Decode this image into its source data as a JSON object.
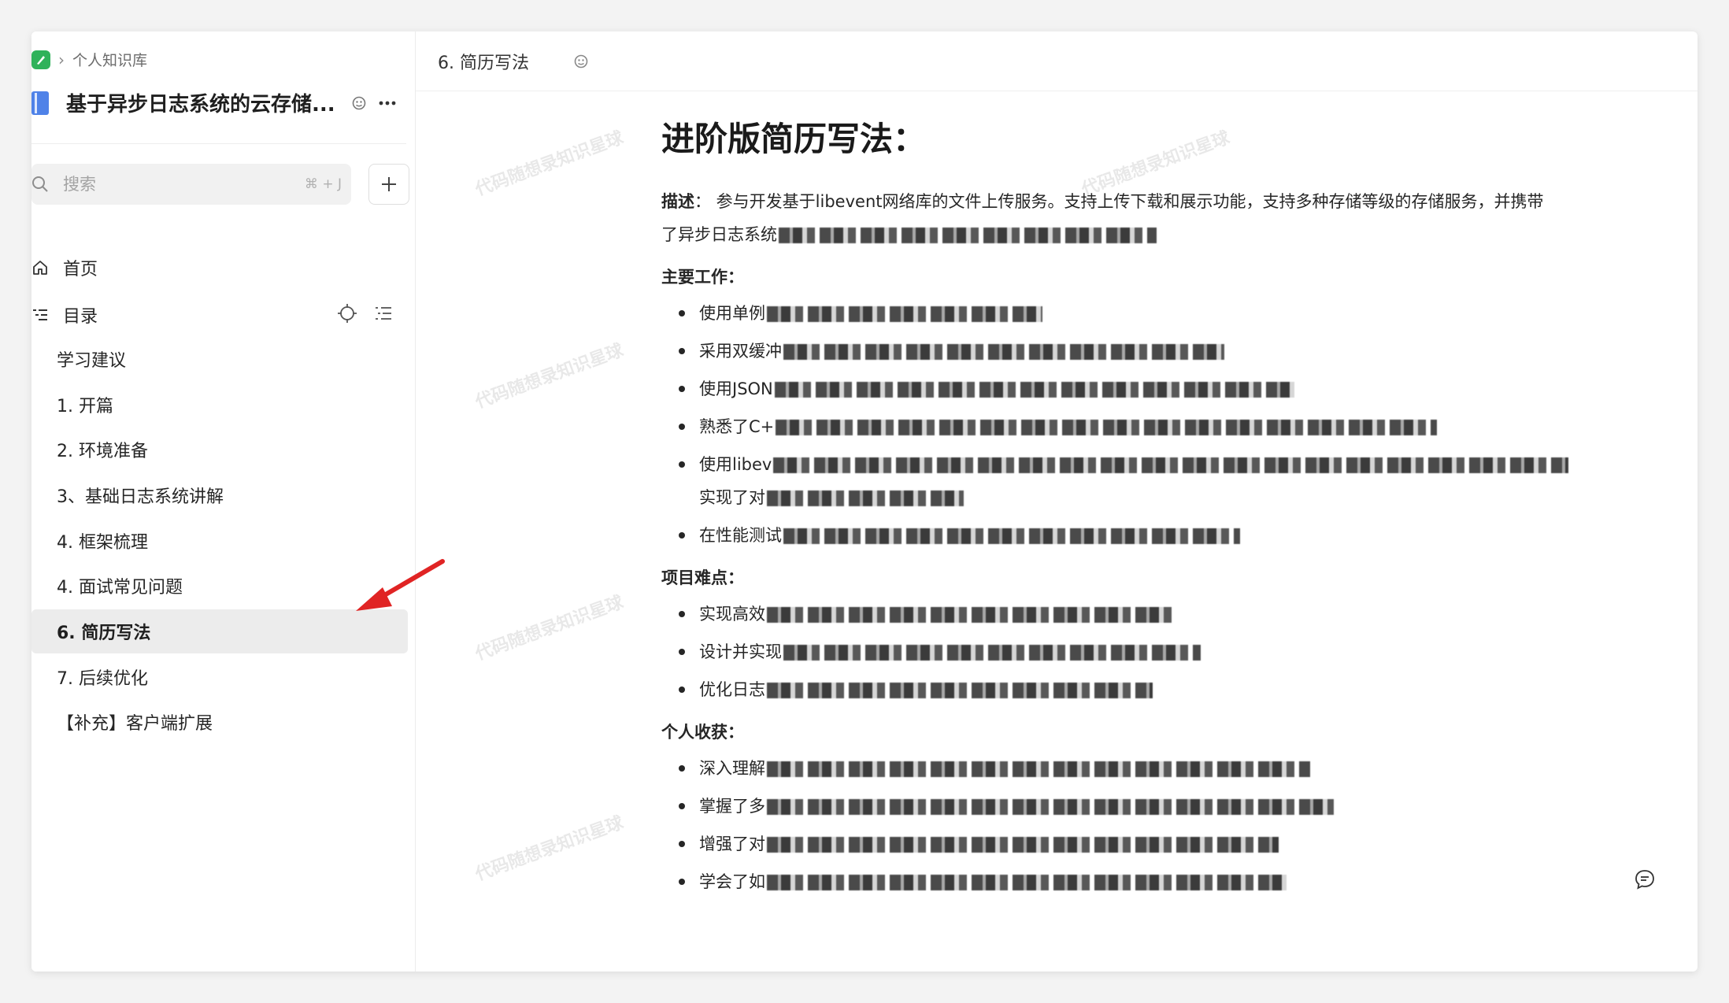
{
  "breadcrumb": {
    "root_label": "个人知识库"
  },
  "book": {
    "title": "基于异步日志系统的云存储..."
  },
  "search": {
    "placeholder": "搜索",
    "shortcut": "⌘ + J"
  },
  "nav": {
    "home_label": "首页",
    "toc_label": "目录"
  },
  "toc": {
    "items": [
      {
        "label": "学习建议"
      },
      {
        "label": "1. 开篇"
      },
      {
        "label": "2. 环境准备"
      },
      {
        "label": "3、基础日志系统讲解"
      },
      {
        "label": "4. 框架梳理"
      },
      {
        "label": "4. 面试常见问题"
      },
      {
        "label": "6. 简历写法"
      },
      {
        "label": "7. 后续优化"
      },
      {
        "label": "【补充】客户端扩展"
      }
    ],
    "active_index": 6
  },
  "tab": {
    "title": "6. 简历写法"
  },
  "doc": {
    "heading": "进阶版简历写法：",
    "desc_label": "描述",
    "desc_line1": "：  参与开发基于libevent网络库的文件上传服务。支持上传下载和展示功能，支持多种存储等级的存储服务，并携带",
    "desc_line2": "了异步日志系统",
    "main_work_heading": "主要工作",
    "main_work": [
      "使用单例",
      "采用双缓冲",
      "使用JSON",
      "熟悉了C+",
      "使用libev",
      "实现了对",
      "在性能测试"
    ],
    "difficulty_heading": "项目难点",
    "difficulties": [
      "实现高效",
      "设计并实现",
      "优化日志"
    ],
    "gains_heading": "个人收获",
    "gains": [
      "深入理解",
      "掌握了多",
      "增强了对",
      "学会了如"
    ]
  },
  "watermark": {
    "text": "代码随想录知识星球"
  },
  "colors": {
    "accent": "#2fb25a",
    "book_icon": "#4f82e8",
    "active_bg": "#ececec",
    "arrow": "#e02424"
  }
}
